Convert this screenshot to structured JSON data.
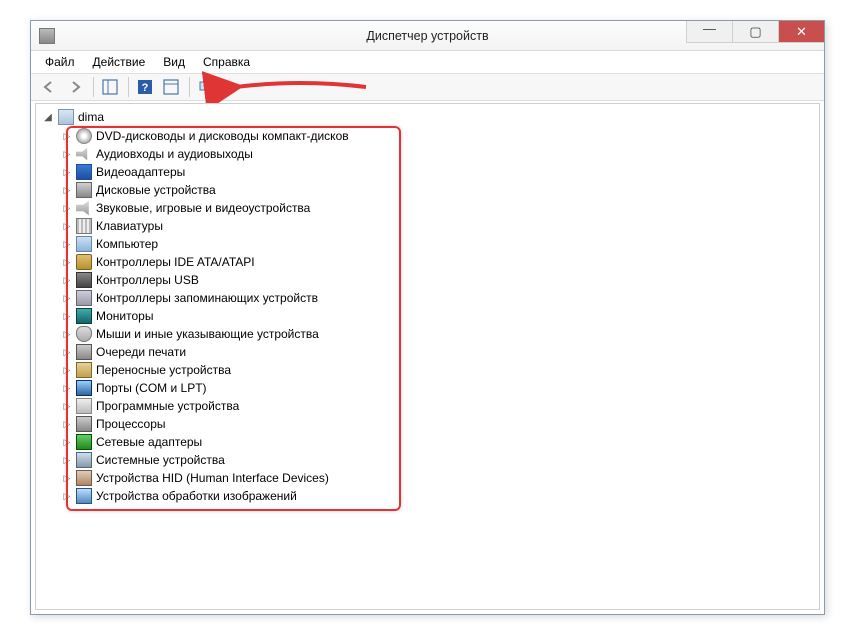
{
  "window": {
    "title": "Диспетчер устройств"
  },
  "menubar": {
    "file": "Файл",
    "action": "Действие",
    "view": "Вид",
    "help": "Справка"
  },
  "tree": {
    "root_label": "dima",
    "items": [
      {
        "label": "DVD-дисководы и дисководы компакт-дисков",
        "icon": "i-dvd",
        "name": "dvd-drives"
      },
      {
        "label": "Аудиовходы и аудиовыходы",
        "icon": "i-audio",
        "name": "audio-io"
      },
      {
        "label": "Видеоадаптеры",
        "icon": "i-video",
        "name": "display-adapters"
      },
      {
        "label": "Дисковые устройства",
        "icon": "i-disk",
        "name": "disk-drives"
      },
      {
        "label": "Звуковые, игровые и видеоустройства",
        "icon": "i-sound",
        "name": "sound-game-video"
      },
      {
        "label": "Клавиатуры",
        "icon": "i-kb",
        "name": "keyboards"
      },
      {
        "label": "Компьютер",
        "icon": "i-pc",
        "name": "computer"
      },
      {
        "label": "Контроллеры IDE ATA/ATAPI",
        "icon": "i-ide",
        "name": "ide-controllers"
      },
      {
        "label": "Контроллеры USB",
        "icon": "i-usb",
        "name": "usb-controllers"
      },
      {
        "label": "Контроллеры запоминающих устройств",
        "icon": "i-store",
        "name": "storage-controllers"
      },
      {
        "label": "Мониторы",
        "icon": "i-mon",
        "name": "monitors"
      },
      {
        "label": "Мыши и иные указывающие устройства",
        "icon": "i-mouse",
        "name": "mice-pointing"
      },
      {
        "label": "Очереди печати",
        "icon": "i-print",
        "name": "print-queues"
      },
      {
        "label": "Переносные устройства",
        "icon": "i-port",
        "name": "portable-devices"
      },
      {
        "label": "Порты (COM и LPT)",
        "icon": "i-com",
        "name": "ports-com-lpt"
      },
      {
        "label": "Программные устройства",
        "icon": "i-prog",
        "name": "software-devices"
      },
      {
        "label": "Процессоры",
        "icon": "i-cpu",
        "name": "processors"
      },
      {
        "label": "Сетевые адаптеры",
        "icon": "i-net",
        "name": "network-adapters"
      },
      {
        "label": "Системные устройства",
        "icon": "i-sys",
        "name": "system-devices"
      },
      {
        "label": "Устройства HID (Human Interface Devices)",
        "icon": "i-hid",
        "name": "hid-devices"
      },
      {
        "label": "Устройства обработки изображений",
        "icon": "i-img",
        "name": "imaging-devices"
      }
    ]
  }
}
